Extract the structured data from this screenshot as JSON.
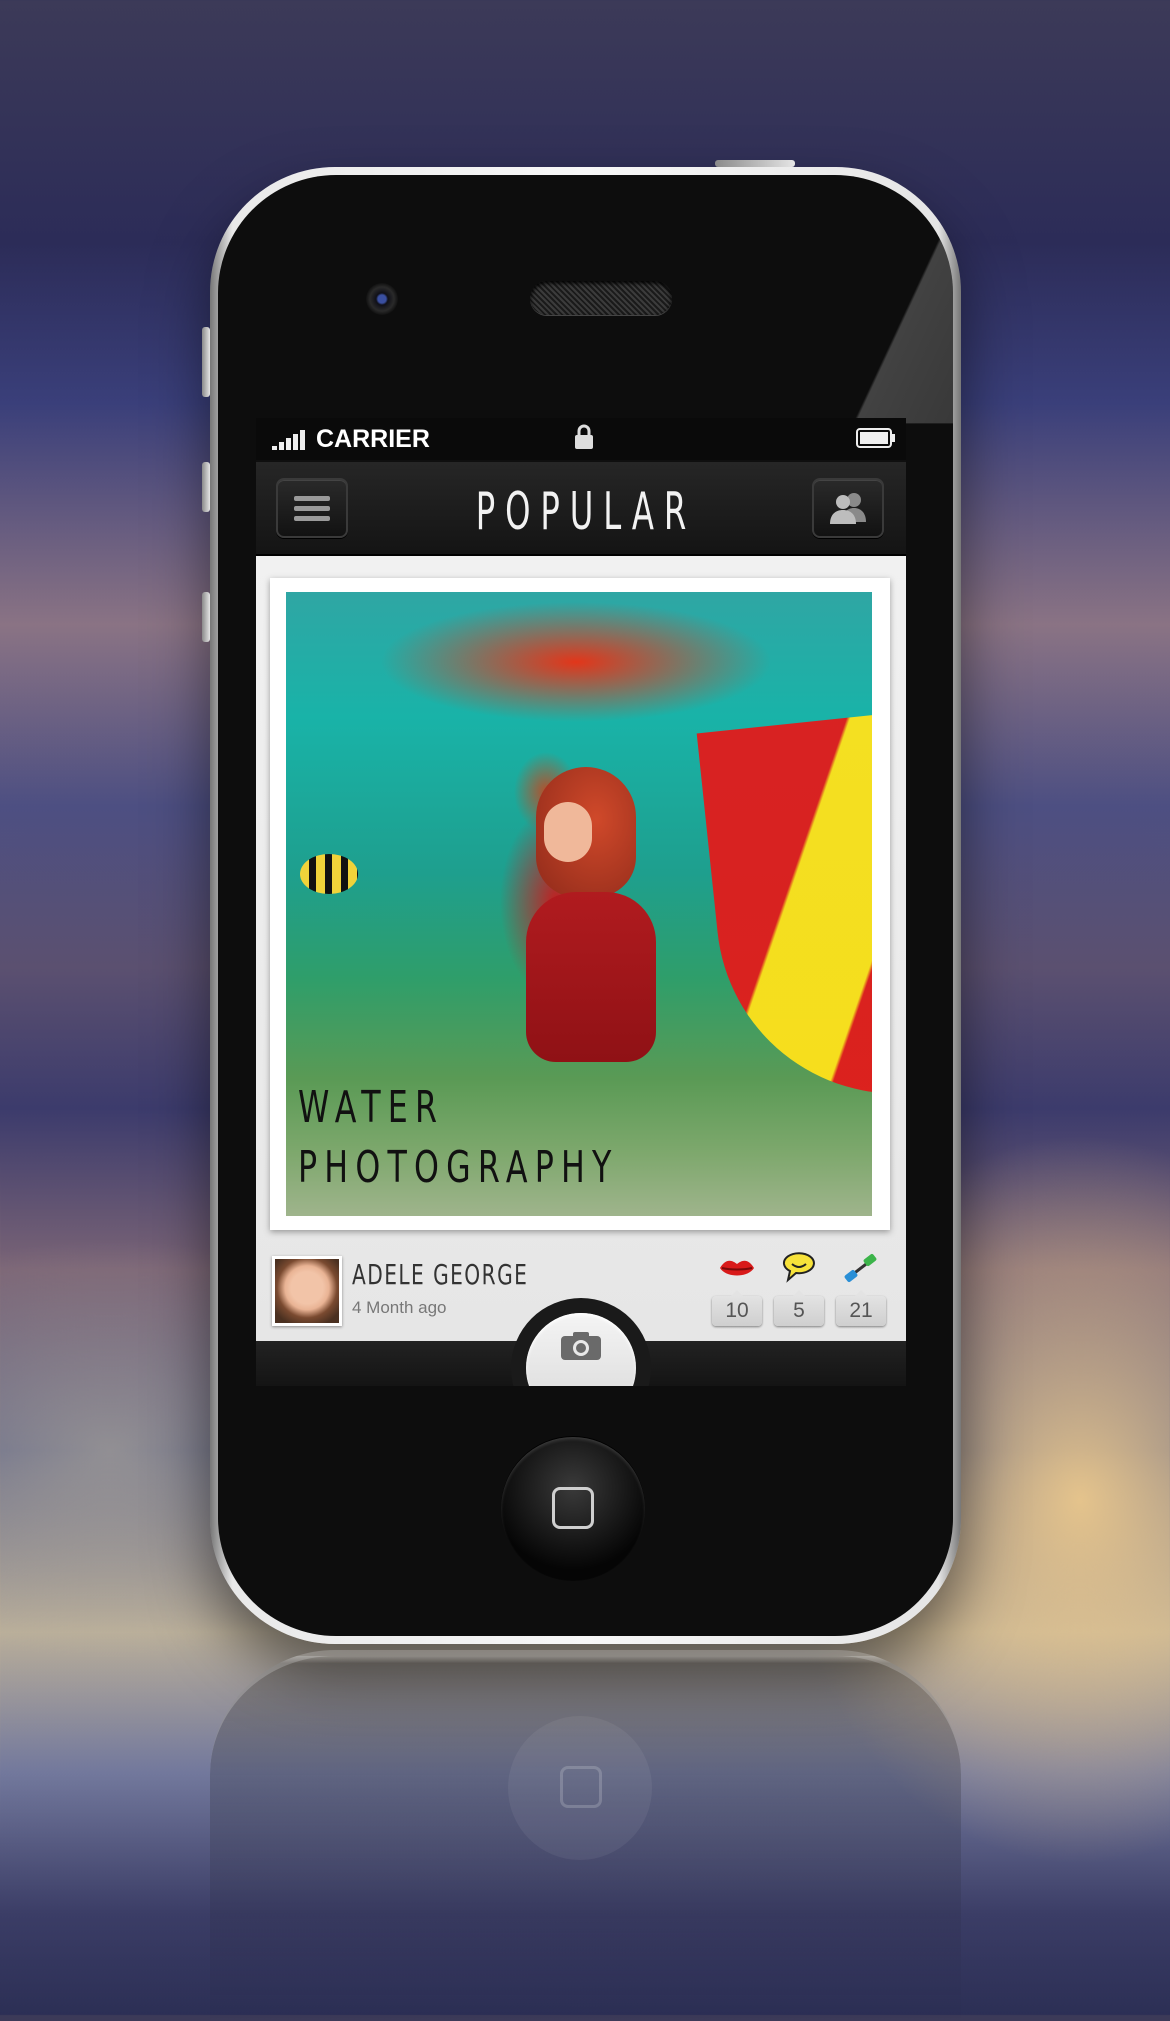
{
  "status_bar": {
    "carrier": "CARRIER",
    "signal_bars": 5,
    "icons": [
      "signal-icon",
      "lock-icon",
      "battery-icon"
    ]
  },
  "nav_bar": {
    "title": "POPULAR",
    "left_icon": "menu-icon",
    "right_icon": "friends-icon"
  },
  "post": {
    "caption_line1": "WATER",
    "caption_line2": "PHOTOGRAPHY",
    "author_name": "ADELE GEORGE",
    "time_ago": "4 Month ago",
    "stats": {
      "kisses": {
        "icon": "lips-icon",
        "count": "10"
      },
      "comments": {
        "icon": "speech-bubble-icon",
        "count": "5"
      },
      "shares": {
        "icon": "share-icon",
        "count": "21"
      }
    }
  },
  "bottom_bar": {
    "center_icon": "camera-icon"
  },
  "colors": {
    "nav_background": "#1c1c1c",
    "content_background": "#ececec",
    "title_text": "#f2f2f2"
  }
}
